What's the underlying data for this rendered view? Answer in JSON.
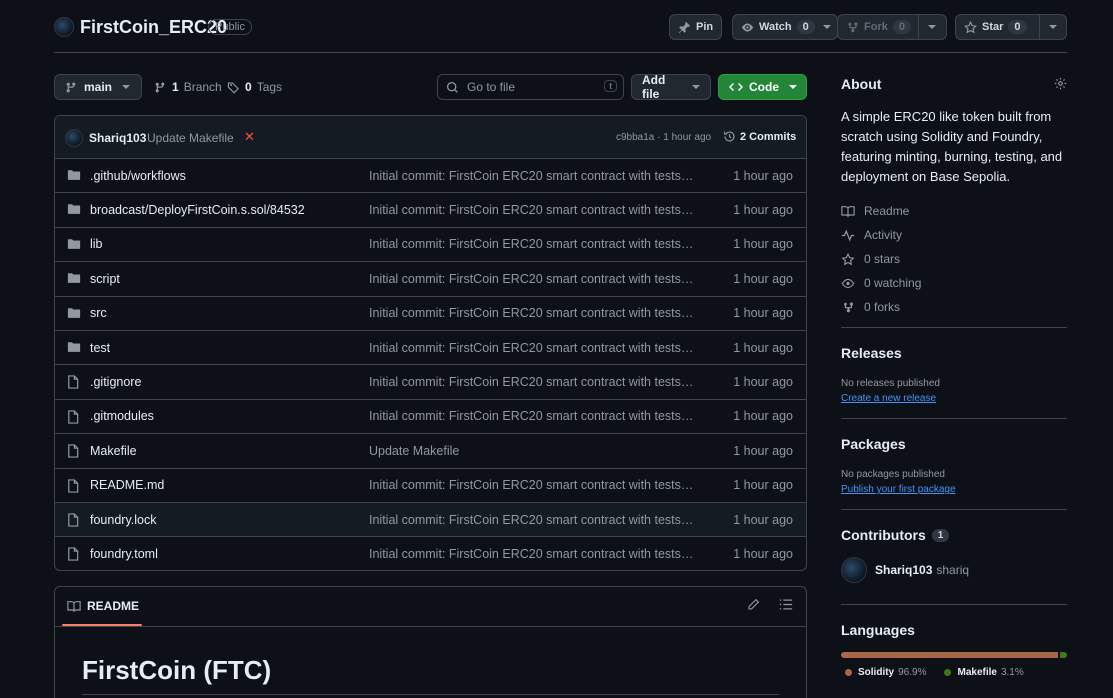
{
  "repo": {
    "name": "FirstCoin_ERC20",
    "visibility": "Public"
  },
  "header_actions": {
    "pin": "Pin",
    "watch": {
      "label": "Watch",
      "count": "0"
    },
    "fork": {
      "label": "Fork",
      "count": "0"
    },
    "star": {
      "label": "Star",
      "count": "0"
    }
  },
  "toolbar": {
    "branch": "main",
    "branch_count": "1",
    "branch_label": "Branch",
    "tags_count": "0",
    "tags_label": "Tags",
    "search_placeholder": "Go to file",
    "search_kbd": "t",
    "add_file": "Add file",
    "code": "Code"
  },
  "latest_commit": {
    "author": "Shariq103",
    "message": "Update Makefile",
    "status": "✕",
    "meta": "c9bba1a · 1 hour ago",
    "commits": "2 Commits"
  },
  "files": [
    {
      "type": "dir",
      "name": ".github/workflows",
      "message": "Initial commit: FirstCoin ERC20 smart contract with tests and ...",
      "time": "1 hour ago"
    },
    {
      "type": "dir",
      "name": "broadcast/DeployFirstCoin.s.sol/84532",
      "message": "Initial commit: FirstCoin ERC20 smart contract with tests and ...",
      "time": "1 hour ago"
    },
    {
      "type": "dir",
      "name": "lib",
      "message": "Initial commit: FirstCoin ERC20 smart contract with tests and ...",
      "time": "1 hour ago"
    },
    {
      "type": "dir",
      "name": "script",
      "message": "Initial commit: FirstCoin ERC20 smart contract with tests and ...",
      "time": "1 hour ago"
    },
    {
      "type": "dir",
      "name": "src",
      "message": "Initial commit: FirstCoin ERC20 smart contract with tests and ...",
      "time": "1 hour ago"
    },
    {
      "type": "dir",
      "name": "test",
      "message": "Initial commit: FirstCoin ERC20 smart contract with tests and ...",
      "time": "1 hour ago"
    },
    {
      "type": "file",
      "name": ".gitignore",
      "message": "Initial commit: FirstCoin ERC20 smart contract with tests and ...",
      "time": "1 hour ago"
    },
    {
      "type": "file",
      "name": ".gitmodules",
      "message": "Initial commit: FirstCoin ERC20 smart contract with tests and ...",
      "time": "1 hour ago"
    },
    {
      "type": "file",
      "name": "Makefile",
      "message": "Update Makefile",
      "time": "1 hour ago"
    },
    {
      "type": "file",
      "name": "README.md",
      "message": "Initial commit: FirstCoin ERC20 smart contract with tests and ...",
      "time": "1 hour ago"
    },
    {
      "type": "file",
      "name": "foundry.lock",
      "message": "Initial commit: FirstCoin ERC20 smart contract with tests and ...",
      "time": "1 hour ago"
    },
    {
      "type": "file",
      "name": "foundry.toml",
      "message": "Initial commit: FirstCoin ERC20 smart contract with tests and ...",
      "time": "1 hour ago"
    }
  ],
  "readme": {
    "tab": "README",
    "heading": "FirstCoin (FTC)"
  },
  "about": {
    "title": "About",
    "description": "A simple ERC20 like token built from scratch using Solidity and Foundry, featuring minting, burning, testing, and deployment on Base Sepolia.",
    "readme": "Readme",
    "activity": "Activity",
    "stars": "0 stars",
    "watching": "0 watching",
    "forks": "0 forks"
  },
  "releases": {
    "title": "Releases",
    "empty": "No releases published",
    "link": "Create a new release"
  },
  "packages": {
    "title": "Packages",
    "empty": "No packages published",
    "link": "Publish your first package"
  },
  "contributors": {
    "title": "Contributors",
    "count": "1",
    "user": "Shariq103",
    "name": "shariq"
  },
  "languages": {
    "title": "Languages",
    "items": [
      {
        "name": "Solidity",
        "percent": "96.9%",
        "value": 96.9,
        "color": "#AA6746"
      },
      {
        "name": "Makefile",
        "percent": "3.1%",
        "value": 3.1,
        "color": "#427819"
      }
    ]
  },
  "icons": [
    "pin-icon",
    "eye-icon",
    "fork-icon",
    "star-icon",
    "branch-icon",
    "tag-icon",
    "search-icon",
    "code-icon",
    "folder-icon",
    "file-icon",
    "history-icon",
    "book-icon",
    "pencil-icon",
    "list-icon",
    "gear-icon",
    "pulse-icon"
  ]
}
